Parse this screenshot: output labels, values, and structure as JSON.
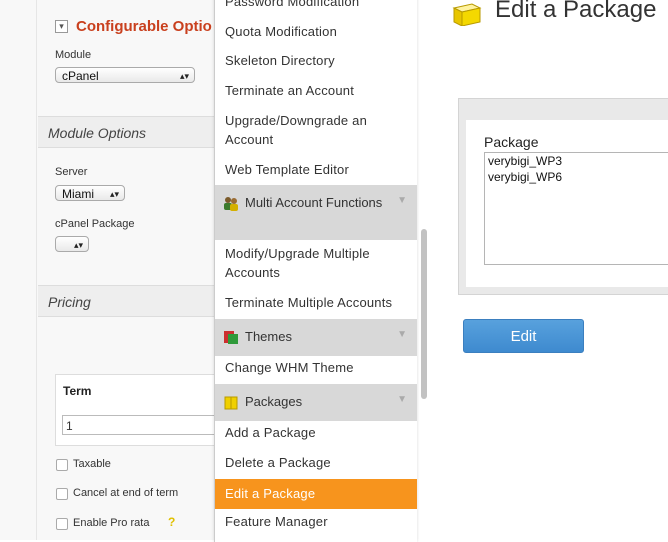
{
  "left": {
    "configurable_title": "Configurable Optio",
    "module_label": "Module",
    "module_value": "cPanel",
    "module_options_heading": "Module Options",
    "server_label": "Server",
    "server_value": "Miami",
    "cpanel_package_label": "cPanel Package",
    "cpanel_package_value": "",
    "pricing_heading": "Pricing",
    "term_header": "Term",
    "term_value": "1",
    "taxable_label": "Taxable",
    "cancel_label": "Cancel at end of term",
    "prorata_label": "Enable Pro rata",
    "help_glyph": "?"
  },
  "menu": {
    "items_top": [
      "Password Modification",
      "Quota Modification",
      "Skeleton Directory",
      "Terminate an Account",
      "Upgrade/Downgrade an Account",
      "Web Template Editor"
    ],
    "multi_account": {
      "title": "Multi Account Functions",
      "items": [
        "Modify/Upgrade Multiple Accounts",
        "Terminate Multiple Accounts"
      ]
    },
    "themes": {
      "title": "Themes",
      "items": [
        "Change WHM Theme"
      ]
    },
    "packages": {
      "title": "Packages",
      "items": [
        "Add a Package",
        "Delete a Package",
        "Edit a Package",
        "Feature Manager"
      ]
    },
    "active_item": "Edit a Package",
    "active_color": "#f7941d"
  },
  "main": {
    "page_title": "Edit a Package",
    "package_label": "Package",
    "package_options": [
      "verybigi_WP3",
      "verybigi_WP6"
    ],
    "edit_button": "Edit",
    "button_color": "#4a90d6"
  }
}
